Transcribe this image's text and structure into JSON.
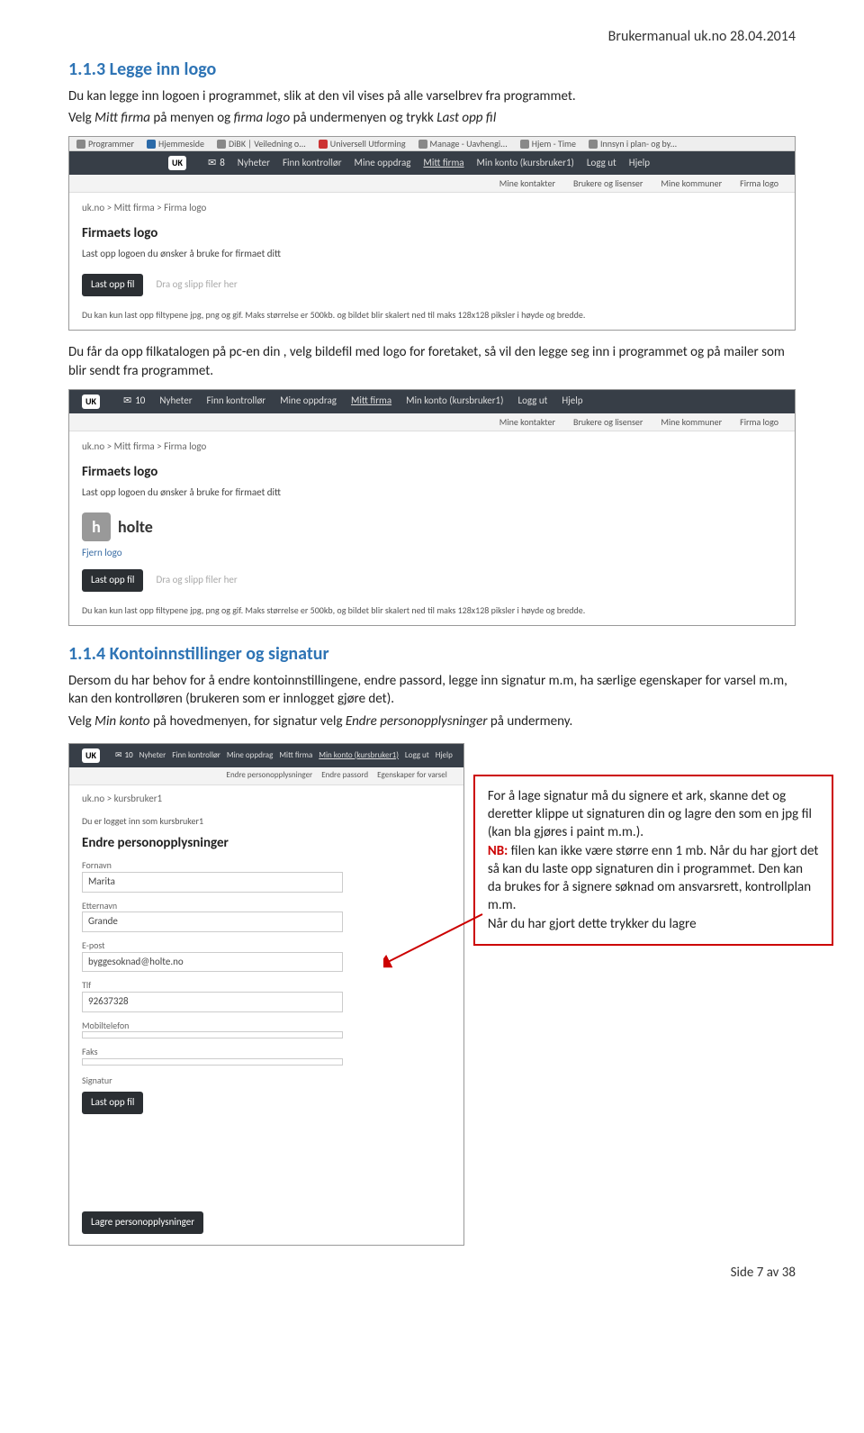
{
  "header": "Brukermanual uk.no 28.04.2014",
  "section1": {
    "number_title": "1.1.3  Legge inn logo",
    "intro": "Du kan legge inn logoen i programmet, slik at den vil vises på alle varselbrev fra programmet.",
    "line2_a": "Velg ",
    "line2_b": "Mitt firma",
    "line2_c": " på menyen og ",
    "line2_d": "firma logo",
    "line2_e": " på undermenyen og trykk ",
    "line2_f": "Last opp fil",
    "after_text_a": "Du får da opp filkatalogen på pc-en din , velg bildefil med logo for foretaket, så vil den legge seg inn i programmet og på mailer som blir sendt fra programmet."
  },
  "browser_tabs": {
    "t1": "Programmer",
    "t2": "Hjemmeside",
    "t3": "DiBK | Veiledning o...",
    "t4": "Universell Utforming",
    "t5": "Manage - Uavhengi...",
    "t6": "Hjem - Time",
    "t7": "Innsyn i plan- og by..."
  },
  "nav": {
    "brand": "UK",
    "badge1": "8",
    "badge2": "10",
    "n1": "Nyheter",
    "n2": "Finn kontrollør",
    "n3": "Mine oppdrag",
    "n4": "Mitt firma",
    "n5": "Min konto (kursbruker1)",
    "n6": "Logg ut",
    "n7": "Hjelp"
  },
  "subnav": {
    "s1": "Mine kontakter",
    "s2": "Brukere og lisenser",
    "s3": "Mine kommuner",
    "s4": "Firma logo",
    "s5": "Endre personopplysninger",
    "s6": "Endre passord",
    "s7": "Egenskaper for varsel"
  },
  "shot1": {
    "bc": "uk.no > Mitt firma > Firma logo",
    "title": "Firmaets logo",
    "sub": "Last opp logoen du ønsker å bruke for firmaet ditt",
    "btn": "Last opp fil",
    "hint": "Dra og slipp filer her",
    "note": "Du kan kun last opp filtypene jpg, png og gif. Maks størrelse er 500kb. og bildet blir skalert ned til maks 128x128 piksler i høyde og bredde."
  },
  "shot2": {
    "bc": "uk.no > Mitt firma > Firma logo",
    "title": "Firmaets logo",
    "sub": "Last opp logoen du ønsker å bruke for firmaet ditt",
    "holte": "holte",
    "fjern": "Fjern logo",
    "btn": "Last opp fil",
    "hint": "Dra og slipp filer her",
    "note": "Du kan kun last opp filtypene jpg, png og gif. Maks størrelse er 500kb, og bildet blir skalert ned til maks 128x128 piksler i høyde og bredde."
  },
  "section2": {
    "number_title": "1.1.4  Kontoinnstillinger og signatur",
    "p1": "Dersom du har behov for å endre kontoinnstillingene, endre passord, legge inn signatur m.m, ha særlige egenskaper for varsel m.m, kan den kontrolløren (brukeren som er innlogget gjøre det).",
    "p2a": "Velg ",
    "p2b": "Min konto",
    "p2c": "  på hovedmenyen, for signatur velg  ",
    "p2d": "Endre personopplysninger",
    "p2e": " på undermeny."
  },
  "shot3": {
    "bc": "uk.no > kursbruker1",
    "logged": "Du er logget inn som kursbruker1",
    "title": "Endre personopplysninger",
    "l_fn": "Fornavn",
    "v_fn": "Marita",
    "l_en": "Etternavn",
    "v_en": "Grande",
    "l_ep": "E-post",
    "v_ep": "byggesoknad@holte.no",
    "l_tlf": "Tlf",
    "v_tlf": "92637328",
    "l_mob": "Mobiltelefon",
    "v_mob": "",
    "l_fax": "Faks",
    "v_fax": "",
    "l_sig": "Signatur",
    "btn": "Last opp fil",
    "save": "Lagre personopplysninger"
  },
  "callout": {
    "l1": "For å lage signatur må du signere et ark, skanne det og deretter klippe ut signaturen din og lagre den som en jpg fil (kan bla gjøres i paint m.m.).",
    "nb": "NB:",
    "l2": " filen kan ikke være større enn 1 mb. Når du har gjort det så kan du laste opp signaturen din i programmet. Den kan da brukes for å signere søknad om ansvarsrett, kontrollplan m.m.",
    "l3": "Når du har gjort dette trykker du lagre"
  },
  "footer": "Side 7 av 38"
}
